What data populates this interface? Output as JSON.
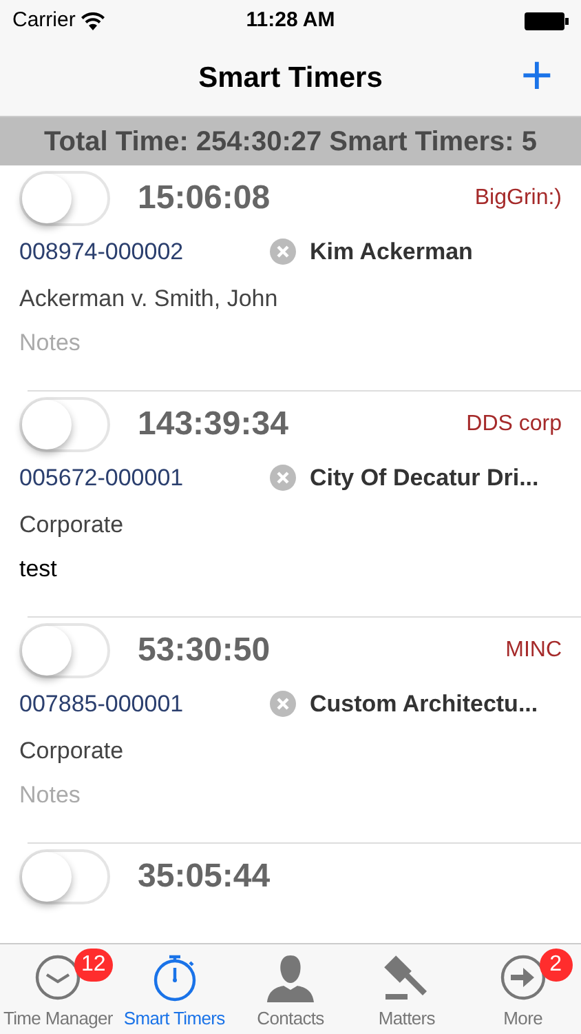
{
  "status_bar": {
    "carrier": "Carrier",
    "time": "11:28 AM"
  },
  "nav": {
    "title": "Smart Timers",
    "add_button": "+"
  },
  "summary": "Total Time: 254:30:27 Smart Timers: 5",
  "timers": [
    {
      "on": false,
      "time": "15:06:08",
      "client": "BigGrin:)",
      "matter_id": "008974-000002",
      "contact": "Kim Ackerman",
      "matter": "Ackerman v. Smith, John",
      "notes": {
        "placeholder": "Notes"
      }
    },
    {
      "on": false,
      "time": "143:39:34",
      "client": "DDS corp",
      "matter_id": "005672-000001",
      "contact": "City Of Decatur Dri...",
      "matter": "Corporate",
      "notes": {
        "value": "test"
      }
    },
    {
      "on": false,
      "time": "53:30:50",
      "client": "MINC",
      "matter_id": "007885-000001",
      "contact": "Custom Architectu...",
      "matter": "Corporate",
      "notes": {
        "placeholder": "Notes"
      }
    },
    {
      "on": false,
      "time": "35:05:44"
    }
  ],
  "tabs": [
    {
      "kind": "clock",
      "label": "Time Manager",
      "selected": false,
      "badge": "12"
    },
    {
      "kind": "stopwatch",
      "label": "Smart Timers",
      "selected": true
    },
    {
      "kind": "person",
      "label": "Contacts",
      "selected": false
    },
    {
      "kind": "gavel",
      "label": "Matters",
      "selected": false
    },
    {
      "kind": "more",
      "label": "More",
      "selected": false,
      "badge": "2"
    }
  ]
}
